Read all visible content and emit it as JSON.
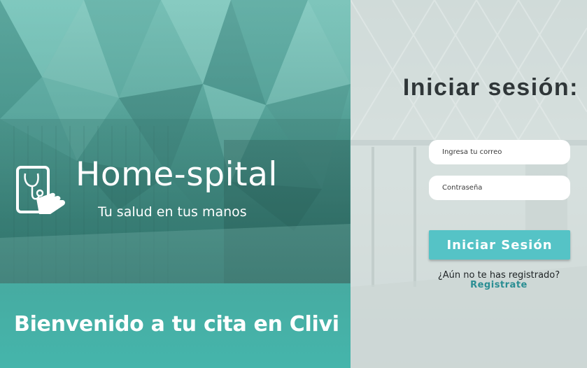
{
  "brand": {
    "name": "Home-spital",
    "tagline": "Tu salud en tus manos",
    "logo_icon": "tablet-stethoscope-hand-icon"
  },
  "welcome": {
    "text": "Bienvenido a tu cita en Clivi"
  },
  "login": {
    "title": "Iniciar sesión:",
    "email_placeholder": "Ingresa tu correo",
    "password_placeholder": "Contraseña",
    "submit_label": "Iniciar Sesión",
    "register_question": "¿Aún no te has registrado?",
    "register_link": "Registrate"
  },
  "colors": {
    "accent": "#55c3c6",
    "link": "#2a8e93",
    "band": "#48afa5",
    "title": "#2f3638"
  }
}
